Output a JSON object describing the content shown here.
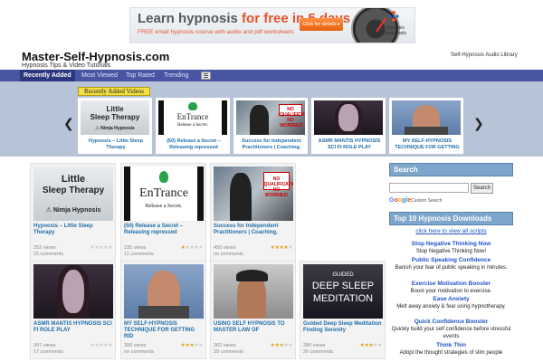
{
  "banner": {
    "title_pre": "Learn hypnosis ",
    "title_hl": "for free in 5 days",
    "subtitle": "FREE email hypnosis course with audio and pdf worksheets",
    "cta": "Click for details ▸",
    "logo_text": "hypnosis downloads"
  },
  "header": {
    "site_title": "Master-Self-Hypnosis.com",
    "tagline": "Hypnosis Tips & Video Tutorials",
    "audio_link": "Self-Hypnosis Audio Library"
  },
  "nav": {
    "items": [
      "Recently Added",
      "Most Viewed",
      "Top Rated",
      "Trending"
    ],
    "active_index": 0
  },
  "slider": {
    "label": "Recently Added Videos",
    "prev": "❮",
    "next": "❯",
    "slides": [
      "Hypnosis – Little Sleep Therapy",
      "(50) Release a Secret – Releasing repressed",
      "Success for Independent Practitioners | Coaching,",
      "ASMR MANTIS HYPNOSIS SCI FI ROLE PLAY",
      "MY SELF-HYPNOSIS TECHNIQUE FOR GETTING"
    ]
  },
  "thumb_text": {
    "sleep_l1": "Little",
    "sleep_l2": "Sleep Therapy",
    "sleep_l3": "⚠ Nimja Hypnosis",
    "entrance": "EnTrance",
    "entrance_sub": "Release a Secret.",
    "no_q": "NO QUALIFICATIONS? NO WORRIES!",
    "guided": "GUIDED",
    "deep_sleep": "DEEP SLEEP",
    "meditation": "MEDITATION"
  },
  "grid": [
    {
      "title": "Hypnosis – Little Sleep Therapy",
      "views": "252 views",
      "comments": "15 comments",
      "stars": 0
    },
    {
      "title": "(50) Release a Secret – Releasing repressed",
      "views": "235 views",
      "comments": "11 comments",
      "stars": 1
    },
    {
      "title": "Success for Independent Practitioners | Coaching,",
      "views": "450 views",
      "comments": "no comments",
      "stars": 4
    },
    {
      "title": "ASMR MANTIS HYPNOSIS SCI FI ROLE PLAY",
      "views": "347 views",
      "comments": "17 comments",
      "stars": 0
    },
    {
      "title": "MY SELF-HYPNOSIS TECHNIQUE FOR GETTING RID",
      "views": "300 views",
      "comments": "no comments",
      "stars": 3
    },
    {
      "title": "USING SELF HYPNOSIS TO MASTER LAW OF",
      "views": "362 views",
      "comments": "29 comments",
      "stars": 3
    },
    {
      "title": "Guided Deep Sleep Meditation Finding Serenity",
      "views": "280 views",
      "comments": "26 comments",
      "stars": 3
    }
  ],
  "sidebar": {
    "search_title": "Search",
    "search_button": "Search",
    "google_brand": "Google",
    "google_custom": "Custom Search",
    "top10_title": "Top 10 Hypnosis Downloads",
    "view_all": "click here to view all scripts",
    "downloads": [
      {
        "title": "Stop Negative Thinking Now",
        "desc": "Stop Negative Thinking Now!"
      },
      {
        "title": "Public Speaking Confidence",
        "desc": "Banish your fear of public speaking in minutes."
      },
      {
        "title": "Exercise Motivation Booster",
        "desc": "Boost your motivation to exercise."
      },
      {
        "title": "Ease Anxiety",
        "desc": "Melt away anxiety & fear using hypnotherapy."
      },
      {
        "title": "Quick Confidence Booster",
        "desc": "Quickly build your self confidence before stressful events"
      },
      {
        "title": "Think Thin",
        "desc": "Adopt the thought strategies of slim people"
      }
    ]
  }
}
